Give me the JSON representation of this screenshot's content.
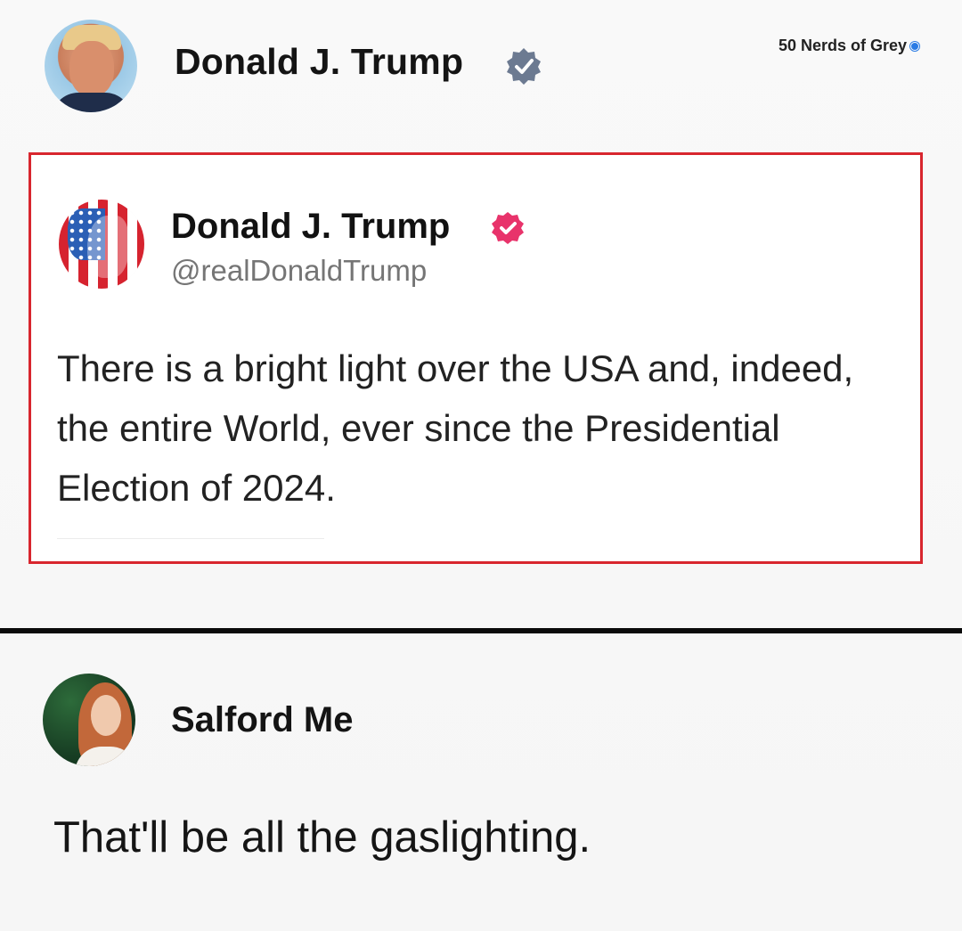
{
  "post": {
    "author_name": "Donald J. Trump",
    "author_avatar_icon": "profile-photo",
    "verified_icon": "verified-badge-icon",
    "verified_color": "#6c7a91"
  },
  "watermark": {
    "text": "50 Nerds of Grey",
    "dot_color": "#2b7be4"
  },
  "quoted_post": {
    "author_name": "Donald J. Trump",
    "handle": "@realDonaldTrump",
    "verified_icon": "verified-badge-icon",
    "verified_color": "#e8336b",
    "border_color": "#d8262e",
    "body": "There is a bright light over the USA and, indeed, the entire World, ever since the Presidential Election of 2024."
  },
  "reply": {
    "author_name": "Salford Me",
    "body": "That'll be all the gaslighting."
  }
}
